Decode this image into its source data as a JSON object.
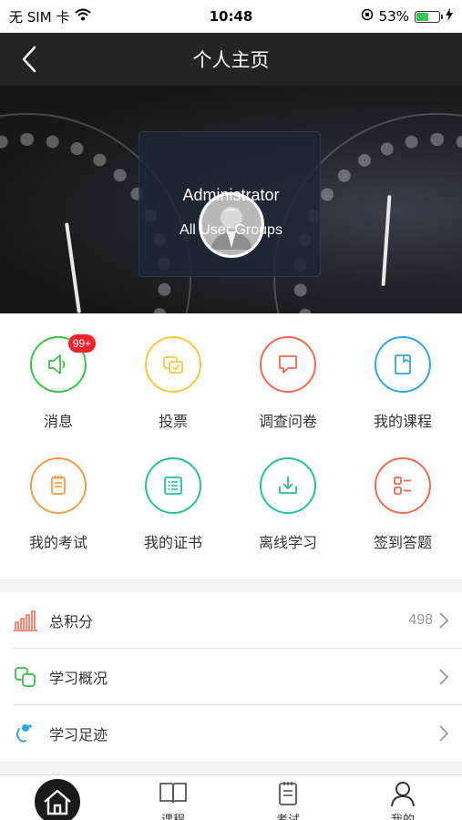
{
  "status_bar": {
    "carrier": "无 SIM 卡",
    "time": "10:48",
    "battery": "53%",
    "battery_level": 0.53
  },
  "nav": {
    "title": "个人主页"
  },
  "profile": {
    "name": "Administrator",
    "group": "All User Groups"
  },
  "grid": {
    "items": [
      {
        "label": "消息",
        "color": "#3cc14a",
        "icon": "speaker-icon",
        "badge": "99+"
      },
      {
        "label": "投票",
        "color": "#f5c842",
        "icon": "vote-icon"
      },
      {
        "label": "调查问卷",
        "color": "#f06a52",
        "icon": "survey-icon"
      },
      {
        "label": "我的课程",
        "color": "#2ea8e0",
        "icon": "course-icon"
      },
      {
        "label": "我的考试",
        "color": "#f39c4a",
        "icon": "exam-icon"
      },
      {
        "label": "我的证书",
        "color": "#25c48d",
        "icon": "certificate-icon"
      },
      {
        "label": "离线学习",
        "color": "#25c48d",
        "icon": "download-icon"
      },
      {
        "label": "签到答题",
        "color": "#f06a52",
        "icon": "checkin-icon"
      }
    ]
  },
  "list": {
    "rows": [
      {
        "label": "总积分",
        "value": "498",
        "icon": "bar-chart-icon",
        "color": "#f06a52"
      },
      {
        "label": "学习概况",
        "value": "",
        "icon": "overlap-squares-icon",
        "color": "#3cc14a"
      },
      {
        "label": "学习足迹",
        "value": "",
        "icon": "footprint-icon",
        "color": "#2ea8e0"
      }
    ]
  },
  "tabs": [
    {
      "label": "",
      "icon": "home-icon"
    },
    {
      "label": "课程",
      "icon": "book-icon"
    },
    {
      "label": "考试",
      "icon": "exam-sheet-icon"
    },
    {
      "label": "我的",
      "icon": "person-icon"
    }
  ]
}
